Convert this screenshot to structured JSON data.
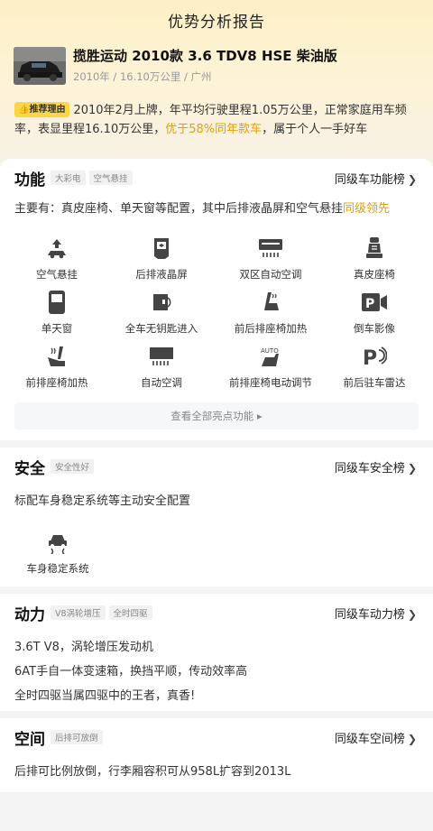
{
  "page_title": "优势分析报告",
  "car": {
    "name": "揽胜运动 2010款 3.6 TDV8 HSE 柴油版",
    "meta": "2010年 / 16.10万公里 / 广州"
  },
  "reason": {
    "badge": "推荐理由",
    "text_before": "2010年2月上牌，年平均行驶里程1.05万公里，正常家庭用车频率，表显里程16.10万公里，",
    "highlight": "优于58%同年款车",
    "text_after": "，属于个人一手好车"
  },
  "function": {
    "title": "功能",
    "tags": [
      "大彩电",
      "空气悬挂"
    ],
    "rank_link": "同级车功能榜",
    "desc_before": "主要有：真皮座椅、单天窗等配置，其中后排液晶屏和空气悬挂",
    "desc_highlight": "同级领先",
    "features": [
      {
        "label": "空气悬挂",
        "icon": "air-suspension-icon"
      },
      {
        "label": "后排液晶屏",
        "icon": "rear-screen-icon"
      },
      {
        "label": "双区自动空调",
        "icon": "dual-zone-ac-icon"
      },
      {
        "label": "真皮座椅",
        "icon": "leather-seat-icon"
      },
      {
        "label": "单天窗",
        "icon": "sunroof-icon"
      },
      {
        "label": "全车无钥匙进入",
        "icon": "keyless-entry-icon"
      },
      {
        "label": "前后排座椅加热",
        "icon": "seat-heating-icon"
      },
      {
        "label": "倒车影像",
        "icon": "reverse-camera-icon"
      },
      {
        "label": "前排座椅加热",
        "icon": "front-seat-heating-icon"
      },
      {
        "label": "自动空调",
        "icon": "auto-ac-icon"
      },
      {
        "label": "前排座椅电动调节",
        "icon": "power-seat-icon"
      },
      {
        "label": "前后驻车雷达",
        "icon": "parking-radar-icon"
      }
    ],
    "more_label": "查看全部亮点功能 ▸"
  },
  "safety": {
    "title": "安全",
    "tags": [
      "安全性好"
    ],
    "rank_link": "同级车安全榜",
    "desc": "标配车身稳定系统等主动安全配置",
    "features": [
      {
        "label": "车身稳定系统",
        "icon": "stability-control-icon"
      }
    ]
  },
  "power": {
    "title": "动力",
    "tags": [
      "V8涡轮增压",
      "全时四驱"
    ],
    "rank_link": "同级车动力榜",
    "lines": [
      "3.6T V8，涡轮增压发动机",
      "6AT手自一体变速箱，换挡平顺，传动效率高",
      "全时四驱当属四驱中的王者，真香!"
    ]
  },
  "space": {
    "title": "空间",
    "tags": [
      "后排可放倒"
    ],
    "rank_link": "同级车空间榜",
    "desc": "后排可比例放倒，行李厢容积可从958L扩容到2013L"
  },
  "colors": {
    "accent": "#e6a100",
    "badge": "#fcd64a"
  }
}
